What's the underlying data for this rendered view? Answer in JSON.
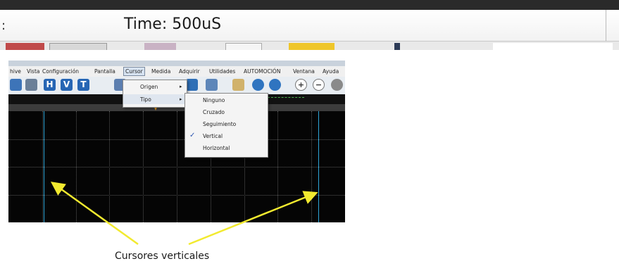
{
  "header": {
    "prefix": ":",
    "time_label": "Time: 500uS"
  },
  "menubar": {
    "items": [
      "hive",
      "Vista",
      "Configuración",
      "Pantalla",
      "Cursor",
      "Medida",
      "Adquirir",
      "Utilidades",
      "AUTOMOCIÓN",
      "Ventana",
      "Ayuda"
    ],
    "active": "Cursor"
  },
  "toolbar": {
    "letters": [
      "H",
      "V",
      "T"
    ]
  },
  "cursor_menu": {
    "items": [
      {
        "label": "Origen",
        "submenu": true
      },
      {
        "label": "Tipo",
        "submenu": true
      }
    ]
  },
  "tipo_menu": {
    "items": [
      {
        "label": "Ninguno",
        "checked": false
      },
      {
        "label": "Cruzado",
        "checked": false
      },
      {
        "label": "Seguimiento",
        "checked": false
      },
      {
        "label": "Vertical",
        "checked": true
      },
      {
        "label": "Horizontal",
        "checked": false
      }
    ],
    "check_mark": "✓"
  },
  "annotation": {
    "caption": "Cursores verticales",
    "arrow_color": "#f2ea2f"
  },
  "colors": {
    "cursor_line": "#2fa6d8",
    "trigger_marker": "#e69a1e",
    "toolbar_button": "#2766b4"
  }
}
